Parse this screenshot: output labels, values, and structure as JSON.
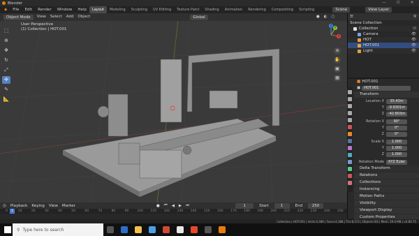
{
  "window": {
    "title": "Blender"
  },
  "menu": [
    "File",
    "Edit",
    "Render",
    "Window",
    "Help"
  ],
  "workspaces": [
    "Layout",
    "Modeling",
    "Sculpting",
    "UV Editing",
    "Texture Paint",
    "Shading",
    "Animation",
    "Rendering",
    "Compositing",
    "Scripting"
  ],
  "active_workspace": "Layout",
  "scene": "Scene",
  "view_layer": "View Layer",
  "header3d": {
    "mode": "Object Mode",
    "view": "View",
    "select": "Select",
    "add": "Add",
    "object": "Object",
    "transform": "Global"
  },
  "viewport": {
    "line1": "User Perspective",
    "line2": "(1) Collection | HOT.001"
  },
  "gizmo": {
    "x": "X",
    "y": "Y",
    "z": "Z"
  },
  "outliner": {
    "title": "Scene Collection",
    "items": [
      {
        "label": "Collection",
        "color": "#e0e0e0"
      },
      {
        "label": "Camera",
        "color": "#7aa3e0"
      },
      {
        "label": "HOT",
        "color": "#e8a040"
      },
      {
        "label": "HOT.001",
        "color": "#e8a040"
      },
      {
        "label": "Light",
        "color": "#e8a040"
      }
    ]
  },
  "properties": {
    "object_name": "HOT.001",
    "data_name": "HOT.001",
    "transform_label": "Transform",
    "location": {
      "label": "Location X",
      "x": "35.43m",
      "y": "-9.9301m",
      "z": "-42.803m"
    },
    "rotation": {
      "label": "Rotation X",
      "x": "90°",
      "y": "0°",
      "z": "0°"
    },
    "scale": {
      "label": "Scale X",
      "x": "1.000",
      "y": "1.000",
      "z": "1.000"
    },
    "rotation_mode": {
      "label": "Rotation Mode",
      "value": "XYZ Euler"
    },
    "delta": "Delta Transform",
    "panels": [
      "Relations",
      "Collections",
      "Instancing",
      "Motion Paths",
      "Visibility",
      "Viewport Display",
      "Custom Properties"
    ]
  },
  "timeline": {
    "menus": [
      "Playback",
      "Keying",
      "View",
      "Marker"
    ],
    "current": "1",
    "start_label": "Start",
    "start": "1",
    "end_label": "End",
    "end": "250",
    "ticks": [
      "0",
      "10",
      "20",
      "30",
      "40",
      "50",
      "60",
      "70",
      "80",
      "90",
      "100",
      "110",
      "120",
      "130",
      "140",
      "150",
      "160",
      "170",
      "180",
      "190",
      "200",
      "210",
      "220",
      "230",
      "240",
      "250"
    ]
  },
  "status": "Collection | HOT.001 | Verts:4,386 | Faces:4,388 | Tris:8,572 | Objects:0/4 | Mem: 29.0 MB | v2.80.75",
  "taskbar": {
    "search": "Type here to search"
  }
}
